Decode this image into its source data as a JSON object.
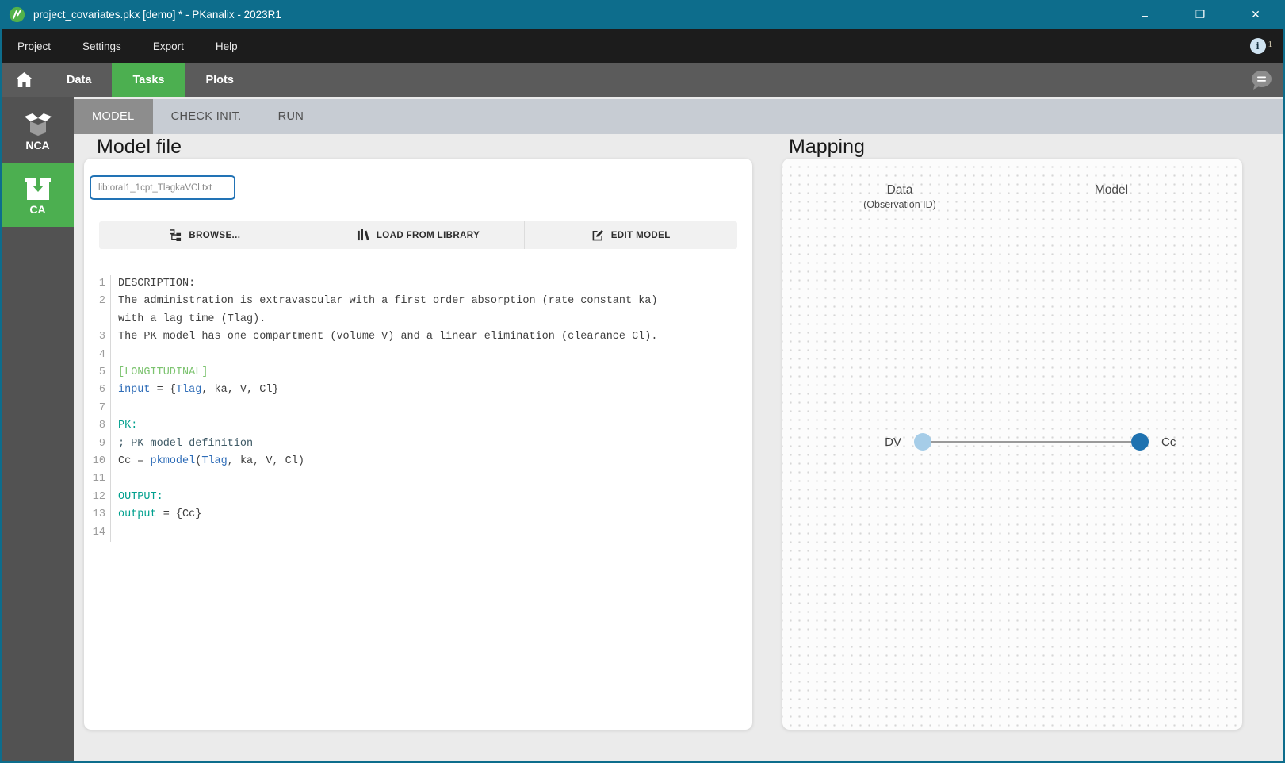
{
  "window": {
    "title": "project_covariates.pkx [demo] * - PKanalix - 2023R1",
    "controls": {
      "minimize": "–",
      "maximize": "❐",
      "close": "✕"
    }
  },
  "menu": {
    "items": [
      "Project",
      "Settings",
      "Export",
      "Help"
    ],
    "info": {
      "glyph": "i",
      "count": "1"
    }
  },
  "nav": {
    "tabs": [
      {
        "label": "Data",
        "active": false
      },
      {
        "label": "Tasks",
        "active": true
      },
      {
        "label": "Plots",
        "active": false
      }
    ]
  },
  "sidebar": {
    "items": [
      {
        "label": "NCA",
        "active": false
      },
      {
        "label": "CA",
        "active": true
      }
    ]
  },
  "subtabs": {
    "items": [
      {
        "label": "MODEL",
        "active": true
      },
      {
        "label": "CHECK INIT.",
        "active": false
      },
      {
        "label": "RUN",
        "active": false
      }
    ]
  },
  "model_file": {
    "title": "Model file",
    "path": "lib:oral1_1cpt_TlagkaVCl.txt",
    "buttons": [
      {
        "label": "BROWSE..."
      },
      {
        "label": "LOAD FROM LIBRARY"
      },
      {
        "label": "EDIT MODEL"
      }
    ],
    "code": {
      "lines": [
        {
          "num": "1",
          "segs": [
            {
              "c": "plain",
              "t": "DESCRIPTION:"
            }
          ]
        },
        {
          "num": "2",
          "segs": [
            {
              "c": "plain",
              "t": "The administration is extravascular with a first order absorption (rate constant ka)"
            },
            {
              "br": true
            },
            {
              "c": "plain",
              "t": "with a lag time (Tlag)."
            }
          ]
        },
        {
          "num": "3",
          "segs": [
            {
              "c": "plain",
              "t": "The PK model has one compartment (volume V) and a linear elimination (clearance Cl)."
            }
          ]
        },
        {
          "num": "4",
          "segs": []
        },
        {
          "num": "5",
          "segs": [
            {
              "c": "section",
              "t": "[LONGITUDINAL]"
            }
          ]
        },
        {
          "num": "6",
          "segs": [
            {
              "c": "keyword",
              "t": "input"
            },
            {
              "c": "plain",
              "t": " = {"
            },
            {
              "c": "keyword",
              "t": "Tlag"
            },
            {
              "c": "plain",
              "t": ", ka, V, Cl}"
            }
          ]
        },
        {
          "num": "7",
          "segs": []
        },
        {
          "num": "8",
          "segs": [
            {
              "c": "block",
              "t": "PK:"
            }
          ]
        },
        {
          "num": "9",
          "segs": [
            {
              "c": "comment",
              "t": "; PK model definition"
            }
          ]
        },
        {
          "num": "10",
          "segs": [
            {
              "c": "plain",
              "t": "Cc = "
            },
            {
              "c": "keyword",
              "t": "pkmodel"
            },
            {
              "c": "plain",
              "t": "("
            },
            {
              "c": "keyword",
              "t": "Tlag"
            },
            {
              "c": "plain",
              "t": ", ka, V, Cl)"
            }
          ]
        },
        {
          "num": "11",
          "segs": []
        },
        {
          "num": "12",
          "segs": [
            {
              "c": "block",
              "t": "OUTPUT:"
            }
          ]
        },
        {
          "num": "13",
          "segs": [
            {
              "c": "block",
              "t": "output"
            },
            {
              "c": "plain",
              "t": " = {Cc}"
            }
          ]
        },
        {
          "num": "14",
          "segs": []
        }
      ]
    }
  },
  "mapping": {
    "title": "Mapping",
    "col_data": "Data",
    "col_data_sub": "(Observation ID)",
    "col_model": "Model",
    "rows": [
      {
        "data_label": "DV",
        "model_label": "Cc"
      }
    ]
  },
  "icons": {
    "app": "pkanalix-logo-icon",
    "home": "home-icon",
    "nca": "open-box-icon",
    "ca": "packed-box-icon",
    "info": "info-circle-icon",
    "chat": "speech-bubble-icon",
    "browse": "file-tree-icon",
    "library": "books-icon",
    "edit": "edit-pencil-icon"
  },
  "colors": {
    "titlebar": "#0d6d8c",
    "accent_green": "#4caf50",
    "accent_blue": "#2273b5",
    "subtab_bar": "#c7ccd3",
    "map_dot_light": "#a6cde8",
    "map_dot_dark": "#1f72b0",
    "code_section": "#7cc36f",
    "code_block": "#00a08e",
    "code_keyword": "#2f6db8"
  }
}
